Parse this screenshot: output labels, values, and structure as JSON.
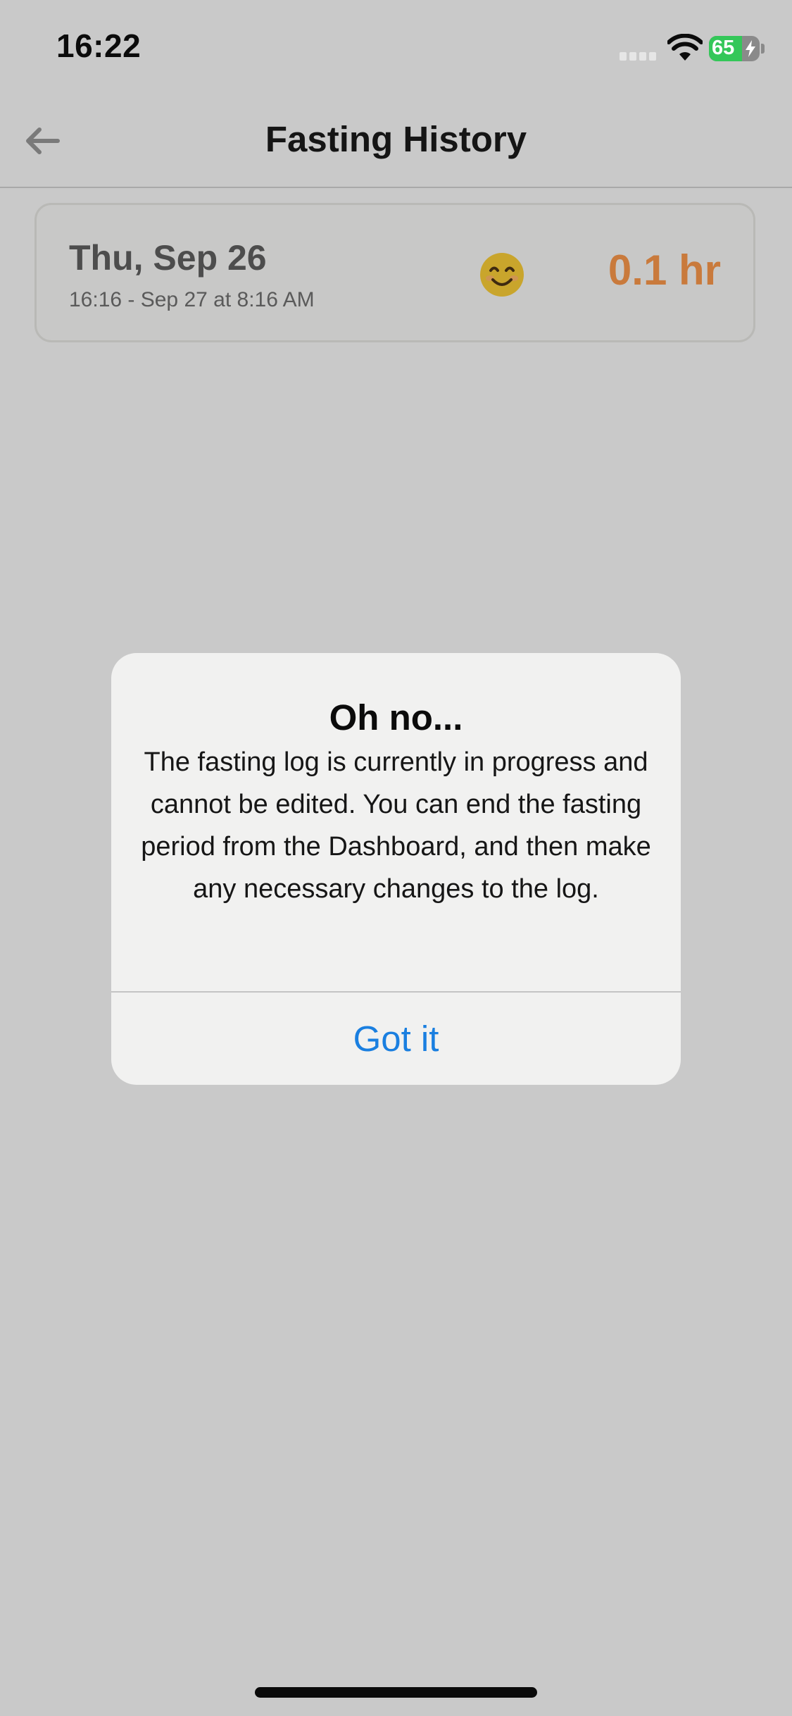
{
  "status_bar": {
    "time": "16:22",
    "battery_percent": "65",
    "battery_level": 0.65,
    "charging": true,
    "wifi_icon": "wifi-icon",
    "signal_icon": "cellular-signal-icon"
  },
  "nav": {
    "title": "Fasting History",
    "back_icon": "arrow-left-icon"
  },
  "log": {
    "date": "Thu, Sep 26",
    "range": "16:16 - Sep 27 at 8:16 AM",
    "mood_emoji": "😊",
    "duration": "0.1 hr"
  },
  "alert": {
    "title": "Oh no...",
    "message": "The fasting log is currently in progress and cannot be edited. You can end the fasting period from the Dashboard, and then make any necessary changes to the log.",
    "button_label": "Got it"
  },
  "colors": {
    "background": "#c9c9c9",
    "accent_blue": "#1a7fe0",
    "duration_orange": "#c97a3c",
    "battery_green": "#34c759"
  }
}
